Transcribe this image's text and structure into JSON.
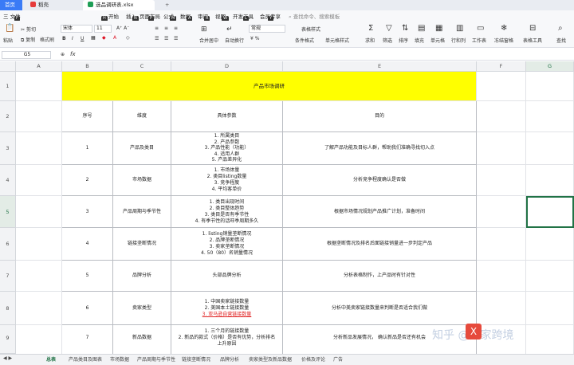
{
  "tabs": {
    "home": "首页",
    "wps": "稻壳",
    "file": "选品调研表.xlsx",
    "plus": "+"
  },
  "menu": {
    "file": "三 文件",
    "items": [
      "开始",
      "插入",
      "页面布局",
      "公式",
      "数据",
      "审阅",
      "视图",
      "开发工具",
      "会员专享"
    ],
    "search": "查找命令、搜索模板",
    "hotkeys": [
      "F",
      "H",
      "N",
      "P",
      "M",
      "A",
      "R",
      "W",
      "L",
      "Y"
    ]
  },
  "toolbar": {
    "paste": "粘贴",
    "cut": "剪切",
    "copy": "复制",
    "format_painter": "格式刷",
    "font": "宋体",
    "size": "11",
    "bold": "B",
    "italic": "I",
    "underline": "U",
    "merge": "合并居中",
    "autowrap": "自动换行",
    "numformat": "常规",
    "table_style": "表格样式",
    "cond_format": "条件格式",
    "cell_style": "单元格样式",
    "sum": "求和",
    "filter": "筛选",
    "sort": "排序",
    "fill": "填充",
    "cell": "单元格",
    "rowcol": "行和列",
    "sheet": "工作表",
    "freeze": "冻结窗格",
    "table_tools": "表格工具",
    "find": "查找",
    "aa": "A⁺ A⁻",
    "yuan": "¥ %"
  },
  "formula": {
    "namebox": "G5",
    "fx": "fx",
    "value": ""
  },
  "columns": [
    "A",
    "B",
    "C",
    "D",
    "E",
    "F",
    "G"
  ],
  "rows": [
    "1",
    "2",
    "3",
    "4",
    "5",
    "6",
    "7",
    "8",
    "9"
  ],
  "title": "产品市场调研",
  "headers": {
    "no": "序号",
    "dimension": "维度",
    "params": "具体参数",
    "purpose": "目的"
  },
  "table": [
    {
      "no": "1",
      "dim": "产品及类目",
      "params": [
        "1. 所属类目",
        "2. 产品参数",
        "3. 产品性能（功能）",
        "4. 适用人群",
        "5. 产品差异化"
      ],
      "purpose": "了解产品功能及目标人群，帮助我们准确寻找切入点"
    },
    {
      "no": "2",
      "dim": "市场数据",
      "params": [
        "1. 市场体量",
        "2. 类目listing数量",
        "3. 竞争程度",
        "4. 平均客单价"
      ],
      "purpose": "分析竞争程度确认是否做"
    },
    {
      "no": "3",
      "dim": "产品周期与季节性",
      "params": [
        "1. 类目出现时间",
        "2. 类目整体趋势",
        "3. 类目是否有季节性",
        "4. 有季节性的话旺季周期多久"
      ],
      "purpose": "根据市场情况规划产品推广计划，准备时间"
    },
    {
      "no": "4",
      "dim": "链接垄断情况",
      "params": [
        "1. listing销量垄断情况",
        "2. 品牌垄断情况",
        "3. 卖家垄断情况",
        "4. 50（80）名销量情况"
      ],
      "purpose": "根据垄断情况及排名后面链接销量进一步判定产品"
    },
    {
      "no": "5",
      "dim": "品牌分析",
      "params": [
        "头部品牌分析"
      ],
      "purpose": "分析表格制作，上产品时有针对性"
    },
    {
      "no": "6",
      "dim": "卖家类型",
      "params": [
        "1. 中国卖家链接数量",
        "2. 美国本土链接数量",
        "3. 亚马逊自营链接数量"
      ],
      "purpose": "分析中美卖家链接数量来判断是否适合我们做"
    },
    {
      "no": "7",
      "dim": "新品数据",
      "params": [
        "1. 三个月的链接数量",
        "2. 新品的款式（价格）是否有优势，分析排名",
        "上升原因"
      ],
      "purpose": "分析新品发展情况，   确认新品是否还有机会"
    }
  ],
  "sheets": [
    "总表",
    "产品类目及图表",
    "市场数据",
    "产品周期与季节性",
    "链接垄断情况",
    "品牌分析",
    "卖家类型及新品数据",
    "价格及评论",
    "广告"
  ],
  "watermark": "知乎 @卖家跨境"
}
